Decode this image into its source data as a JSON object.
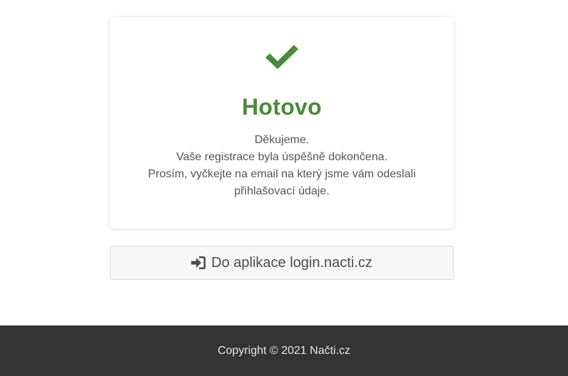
{
  "card": {
    "title": "Hotovo",
    "icon": "checkmark-icon",
    "icon_color": "#4a8a3a",
    "lines": [
      "Děkujeme.",
      "Vaše registrace byla úspěšně dokončena.",
      "Prosím, vyčkejte na email na který jsme vám odeslali přihlašovací údaje."
    ]
  },
  "login_button": {
    "icon": "sign-in-icon",
    "label": "Do aplikace login.nacti.cz"
  },
  "footer": {
    "text": "Copyright © 2021 Načti.cz",
    "background": "#343434"
  }
}
